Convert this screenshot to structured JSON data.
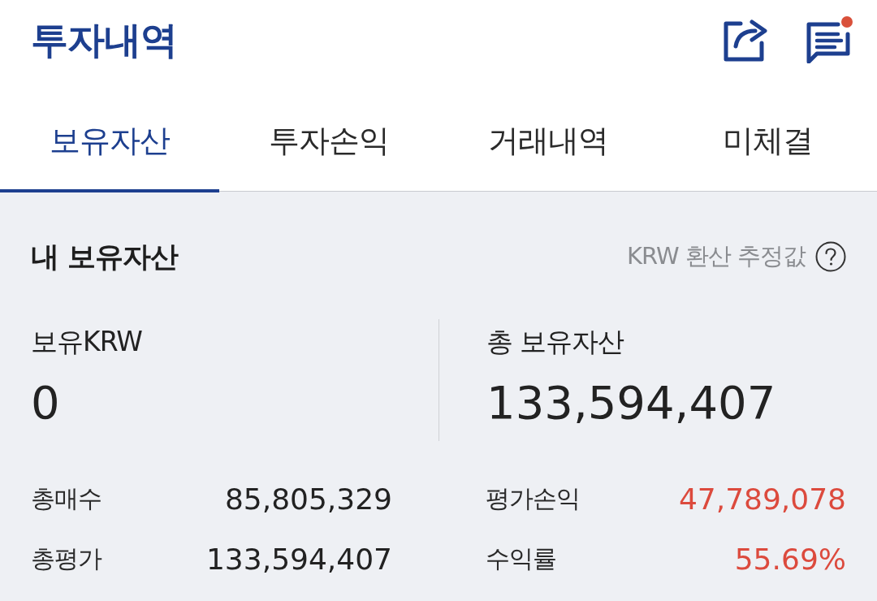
{
  "header": {
    "title": "투자내역",
    "unread": true
  },
  "tabs": [
    {
      "label": "보유자산",
      "selected": true
    },
    {
      "label": "투자손익",
      "selected": false
    },
    {
      "label": "거래내역",
      "selected": false
    },
    {
      "label": "미체결",
      "selected": false
    }
  ],
  "holdings": {
    "title": "내 보유자산",
    "note": "KRW 환산 추정값",
    "summary": [
      {
        "label": "보유KRW",
        "value": "0"
      },
      {
        "label": "총 보유자산",
        "value": "133,594,407"
      }
    ],
    "details": [
      {
        "label": "총매수",
        "value": "85,805,329",
        "color": "#222222"
      },
      {
        "label": "평가손익",
        "value": "47,789,078",
        "color": "#dc4a3d"
      },
      {
        "label": "총평가",
        "value": "133,594,407",
        "color": "#222222"
      },
      {
        "label": "수익률",
        "value": "55.69%",
        "color": "#dc4a3d"
      }
    ]
  }
}
